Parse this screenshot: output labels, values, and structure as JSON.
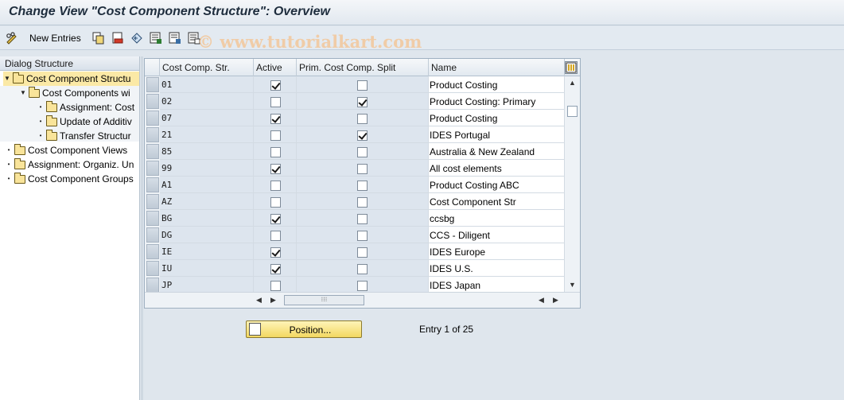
{
  "window": {
    "title": "Change View \"Cost Component Structure\": Overview"
  },
  "toolbar": {
    "new_entries_label": "New Entries",
    "watermark": "© www.tutorialkart.com"
  },
  "dialog": {
    "header": "Dialog Structure",
    "tree": [
      {
        "label": "Cost Component Structu",
        "mark": "▼",
        "selected": true
      },
      {
        "label": "Cost Components wi",
        "mark": "▼",
        "selected": false
      },
      {
        "label": "Assignment: Cost",
        "mark": "•",
        "selected": false
      },
      {
        "label": "Update of Additiv",
        "mark": "•",
        "selected": false
      },
      {
        "label": "Transfer Structur",
        "mark": "•",
        "selected": false
      },
      {
        "label": "Cost Component Views",
        "mark": "•",
        "selected": false
      },
      {
        "label": "Assignment: Organiz. Un",
        "mark": "•",
        "selected": false
      },
      {
        "label": "Cost Component Groups",
        "mark": "•",
        "selected": false
      }
    ]
  },
  "table": {
    "columns": [
      "Cost Comp. Str.",
      "Active",
      "Prim. Cost Comp. Split",
      "Name"
    ],
    "rows": [
      {
        "code": "01",
        "active": true,
        "prim": false,
        "name": "Product Costing"
      },
      {
        "code": "02",
        "active": false,
        "prim": true,
        "name": "Product Costing: Primary"
      },
      {
        "code": "07",
        "active": true,
        "prim": false,
        "name": "Product Costing"
      },
      {
        "code": "21",
        "active": false,
        "prim": true,
        "name": "IDES Portugal"
      },
      {
        "code": "85",
        "active": false,
        "prim": false,
        "name": "Australia & New Zealand"
      },
      {
        "code": "99",
        "active": true,
        "prim": false,
        "name": "All cost elements"
      },
      {
        "code": "A1",
        "active": false,
        "prim": false,
        "name": "Product Costing ABC"
      },
      {
        "code": "AZ",
        "active": false,
        "prim": false,
        "name": "Cost Component Str"
      },
      {
        "code": "BG",
        "active": true,
        "prim": false,
        "name": "ccsbg"
      },
      {
        "code": "DG",
        "active": false,
        "prim": false,
        "name": "CCS - Diligent"
      },
      {
        "code": "IE",
        "active": true,
        "prim": false,
        "name": "IDES Europe"
      },
      {
        "code": "IU",
        "active": true,
        "prim": false,
        "name": "IDES U.S."
      },
      {
        "code": "JP",
        "active": false,
        "prim": false,
        "name": "IDES Japan"
      }
    ]
  },
  "footer": {
    "position_label": "Position...",
    "entry_text": "Entry 1 of 25"
  }
}
